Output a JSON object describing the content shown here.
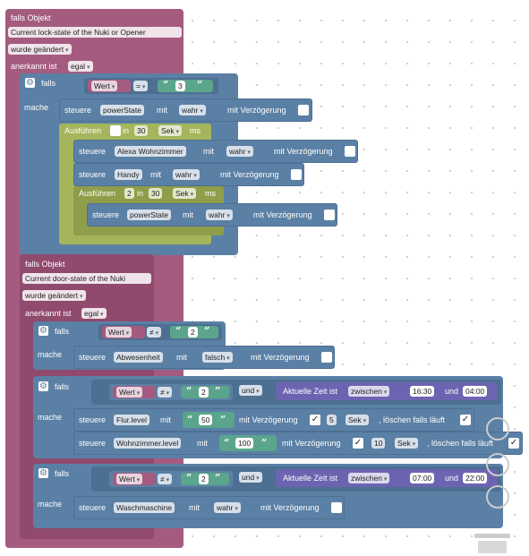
{
  "trigger1": {
    "title": "falls Objekt",
    "object": "Current lock-state of the Nuki or Opener",
    "condition": "wurde geändert",
    "ack_label": "anerkannt ist",
    "ack_value": "egal"
  },
  "if1": {
    "falls": "falls",
    "mache": "mache",
    "compare_left": "Wert",
    "compare_op": "=",
    "compare_value": "3",
    "set1": {
      "verb": "steuere",
      "target": "powerState",
      "mit": "mit",
      "value": "wahr",
      "delay_label": "mit Verzögerung"
    },
    "timeout": {
      "label": "Ausführen",
      "in": "in",
      "amount": "30",
      "unit": "Sek",
      "ms": "ms"
    },
    "set2": {
      "verb": "steuere",
      "target": "Alexa Wohnzimmer",
      "mit": "mit",
      "value": "wahr",
      "delay_label": "mit Verzögerung"
    },
    "set3": {
      "verb": "steuere",
      "target": "Handy",
      "mit": "mit",
      "value": "wahr",
      "delay_label": "mit Verzögerung"
    },
    "timeout2": {
      "label": "Ausführen",
      "count": "2",
      "in": "in",
      "amount": "30",
      "unit": "Sek",
      "ms": "ms"
    },
    "set4": {
      "verb": "steuere",
      "target": "powerState",
      "mit": "mit",
      "value": "wahr",
      "delay_label": "mit Verzögerung"
    }
  },
  "trigger2": {
    "title": "falls Objekt",
    "object": "Current door-state of the Nuki",
    "condition": "wurde geändert",
    "ack_label": "anerkannt ist",
    "ack_value": "egal"
  },
  "if2": {
    "falls": "falls",
    "mache": "mache",
    "compare_left": "Wert",
    "compare_op": "≠",
    "compare_value": "2",
    "set1": {
      "verb": "steuere",
      "target": "Abwesenheit",
      "mit": "mit",
      "value": "falsch",
      "delay_label": "mit Verzögerung"
    }
  },
  "if3": {
    "falls": "falls",
    "mache": "mache",
    "compare_left": "Wert",
    "compare_op": "≠",
    "compare_value": "2",
    "and": "und",
    "time_label": "Aktuelle Zeit ist",
    "time_mode": "zwischen",
    "time_from": "16:30",
    "time_und": "und",
    "time_to": "04:00",
    "set1": {
      "verb": "steuere",
      "target": "Flur.level",
      "mit": "mit",
      "value": "50",
      "delay_label": "mit Verzögerung",
      "check": "✓",
      "amount": "5",
      "unit": "Sek",
      "clear_label": ", löschen falls läuft",
      "clear_check": "✓"
    },
    "set2": {
      "verb": "steuere",
      "target": "Wohnzimmer.level",
      "mit": "mit",
      "value": "100",
      "delay_label": "mit Verzögerung",
      "check": "✓",
      "amount": "10",
      "unit": "Sek",
      "clear_label": ", löschen falls läuft",
      "clear_check": "✓"
    }
  },
  "if4": {
    "falls": "falls",
    "mache": "mache",
    "compare_left": "Wert",
    "compare_op": "≠",
    "compare_value": "2",
    "and": "und",
    "time_label": "Aktuelle Zeit ist",
    "time_mode": "zwischen",
    "time_from": "07:00",
    "time_und": "und",
    "time_to": "22:00",
    "set1": {
      "verb": "steuere",
      "target": "Waschmaschine",
      "mit": "mit",
      "value": "wahr",
      "delay_label": "mit Verzögerung"
    }
  },
  "icons": {
    "gear": "⚙",
    "quote_open": "“",
    "quote_close": "”"
  },
  "colors": {
    "event": "#a55b80",
    "logic": "#5b80a5",
    "timeout": "#a5b55b",
    "text": "#5ba58c",
    "time": "#6d64b1"
  }
}
